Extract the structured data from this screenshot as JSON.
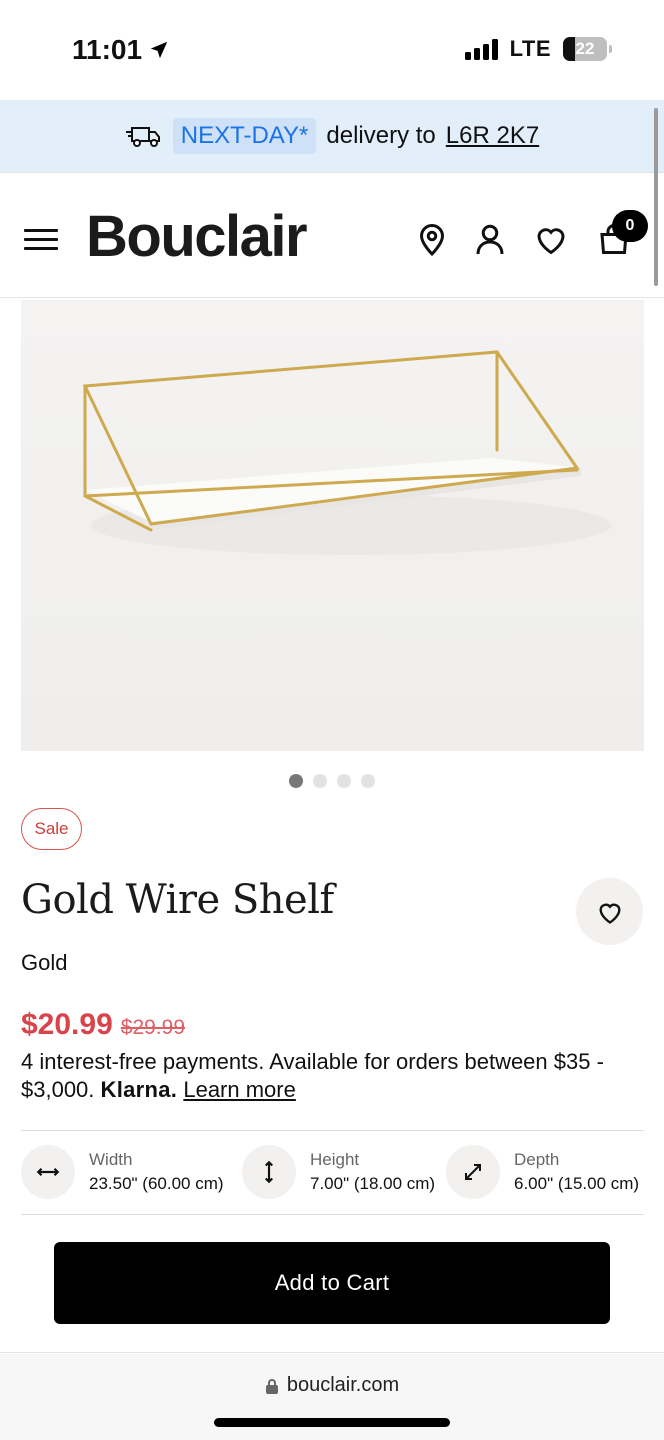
{
  "status_bar": {
    "time": "11:01",
    "network": "LTE",
    "battery": "22"
  },
  "delivery_banner": {
    "tag": "NEXT-DAY*",
    "text": "delivery to",
    "postal_code": "L6R 2K7"
  },
  "header": {
    "logo": "Bouclair",
    "cart_count": "0"
  },
  "gallery": {
    "total_images": 4,
    "active_index": 0
  },
  "product": {
    "badge": "Sale",
    "title": "Gold Wire Shelf",
    "color": "Gold",
    "price": "$20.99",
    "original_price": "$29.99",
    "klarna_text": "4 interest-free payments. Available for orders between $35 - $3,000.",
    "klarna_brand": "Klarna.",
    "learn_more": "Learn more",
    "dimensions": [
      {
        "label": "Width",
        "value": "23.50\" (60.00 cm)",
        "icon": "horizontal-arrows-icon"
      },
      {
        "label": "Height",
        "value": "7.00\" (18.00 cm)",
        "icon": "vertical-arrows-icon"
      },
      {
        "label": "Depth",
        "value": "6.00\" (15.00 cm)",
        "icon": "diagonal-arrows-icon"
      }
    ]
  },
  "add_to_cart": "Add to Cart",
  "browser": {
    "url": "bouclair.com"
  },
  "colors": {
    "accent_blue": "#1a73e8",
    "sale_red": "#d9434a",
    "banner_bg": "#e3eefb"
  }
}
